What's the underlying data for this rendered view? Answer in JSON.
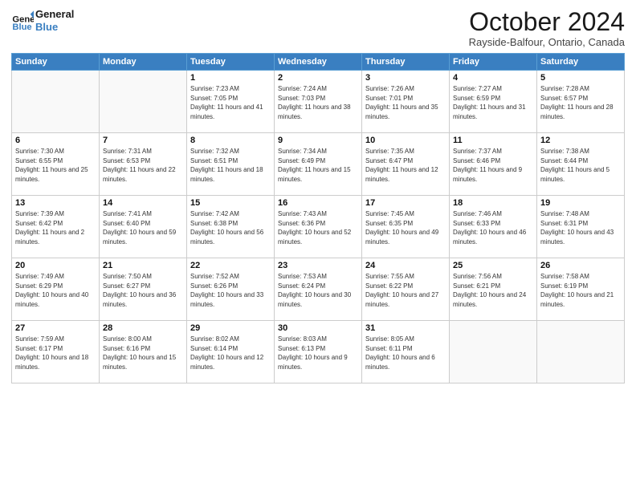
{
  "header": {
    "logo_line1": "General",
    "logo_line2": "Blue",
    "month": "October 2024",
    "location": "Rayside-Balfour, Ontario, Canada"
  },
  "days_of_week": [
    "Sunday",
    "Monday",
    "Tuesday",
    "Wednesday",
    "Thursday",
    "Friday",
    "Saturday"
  ],
  "weeks": [
    [
      {
        "day": "",
        "info": ""
      },
      {
        "day": "",
        "info": ""
      },
      {
        "day": "1",
        "info": "Sunrise: 7:23 AM\nSunset: 7:05 PM\nDaylight: 11 hours and 41 minutes."
      },
      {
        "day": "2",
        "info": "Sunrise: 7:24 AM\nSunset: 7:03 PM\nDaylight: 11 hours and 38 minutes."
      },
      {
        "day": "3",
        "info": "Sunrise: 7:26 AM\nSunset: 7:01 PM\nDaylight: 11 hours and 35 minutes."
      },
      {
        "day": "4",
        "info": "Sunrise: 7:27 AM\nSunset: 6:59 PM\nDaylight: 11 hours and 31 minutes."
      },
      {
        "day": "5",
        "info": "Sunrise: 7:28 AM\nSunset: 6:57 PM\nDaylight: 11 hours and 28 minutes."
      }
    ],
    [
      {
        "day": "6",
        "info": "Sunrise: 7:30 AM\nSunset: 6:55 PM\nDaylight: 11 hours and 25 minutes."
      },
      {
        "day": "7",
        "info": "Sunrise: 7:31 AM\nSunset: 6:53 PM\nDaylight: 11 hours and 22 minutes."
      },
      {
        "day": "8",
        "info": "Sunrise: 7:32 AM\nSunset: 6:51 PM\nDaylight: 11 hours and 18 minutes."
      },
      {
        "day": "9",
        "info": "Sunrise: 7:34 AM\nSunset: 6:49 PM\nDaylight: 11 hours and 15 minutes."
      },
      {
        "day": "10",
        "info": "Sunrise: 7:35 AM\nSunset: 6:47 PM\nDaylight: 11 hours and 12 minutes."
      },
      {
        "day": "11",
        "info": "Sunrise: 7:37 AM\nSunset: 6:46 PM\nDaylight: 11 hours and 9 minutes."
      },
      {
        "day": "12",
        "info": "Sunrise: 7:38 AM\nSunset: 6:44 PM\nDaylight: 11 hours and 5 minutes."
      }
    ],
    [
      {
        "day": "13",
        "info": "Sunrise: 7:39 AM\nSunset: 6:42 PM\nDaylight: 11 hours and 2 minutes."
      },
      {
        "day": "14",
        "info": "Sunrise: 7:41 AM\nSunset: 6:40 PM\nDaylight: 10 hours and 59 minutes."
      },
      {
        "day": "15",
        "info": "Sunrise: 7:42 AM\nSunset: 6:38 PM\nDaylight: 10 hours and 56 minutes."
      },
      {
        "day": "16",
        "info": "Sunrise: 7:43 AM\nSunset: 6:36 PM\nDaylight: 10 hours and 52 minutes."
      },
      {
        "day": "17",
        "info": "Sunrise: 7:45 AM\nSunset: 6:35 PM\nDaylight: 10 hours and 49 minutes."
      },
      {
        "day": "18",
        "info": "Sunrise: 7:46 AM\nSunset: 6:33 PM\nDaylight: 10 hours and 46 minutes."
      },
      {
        "day": "19",
        "info": "Sunrise: 7:48 AM\nSunset: 6:31 PM\nDaylight: 10 hours and 43 minutes."
      }
    ],
    [
      {
        "day": "20",
        "info": "Sunrise: 7:49 AM\nSunset: 6:29 PM\nDaylight: 10 hours and 40 minutes."
      },
      {
        "day": "21",
        "info": "Sunrise: 7:50 AM\nSunset: 6:27 PM\nDaylight: 10 hours and 36 minutes."
      },
      {
        "day": "22",
        "info": "Sunrise: 7:52 AM\nSunset: 6:26 PM\nDaylight: 10 hours and 33 minutes."
      },
      {
        "day": "23",
        "info": "Sunrise: 7:53 AM\nSunset: 6:24 PM\nDaylight: 10 hours and 30 minutes."
      },
      {
        "day": "24",
        "info": "Sunrise: 7:55 AM\nSunset: 6:22 PM\nDaylight: 10 hours and 27 minutes."
      },
      {
        "day": "25",
        "info": "Sunrise: 7:56 AM\nSunset: 6:21 PM\nDaylight: 10 hours and 24 minutes."
      },
      {
        "day": "26",
        "info": "Sunrise: 7:58 AM\nSunset: 6:19 PM\nDaylight: 10 hours and 21 minutes."
      }
    ],
    [
      {
        "day": "27",
        "info": "Sunrise: 7:59 AM\nSunset: 6:17 PM\nDaylight: 10 hours and 18 minutes."
      },
      {
        "day": "28",
        "info": "Sunrise: 8:00 AM\nSunset: 6:16 PM\nDaylight: 10 hours and 15 minutes."
      },
      {
        "day": "29",
        "info": "Sunrise: 8:02 AM\nSunset: 6:14 PM\nDaylight: 10 hours and 12 minutes."
      },
      {
        "day": "30",
        "info": "Sunrise: 8:03 AM\nSunset: 6:13 PM\nDaylight: 10 hours and 9 minutes."
      },
      {
        "day": "31",
        "info": "Sunrise: 8:05 AM\nSunset: 6:11 PM\nDaylight: 10 hours and 6 minutes."
      },
      {
        "day": "",
        "info": ""
      },
      {
        "day": "",
        "info": ""
      }
    ]
  ]
}
